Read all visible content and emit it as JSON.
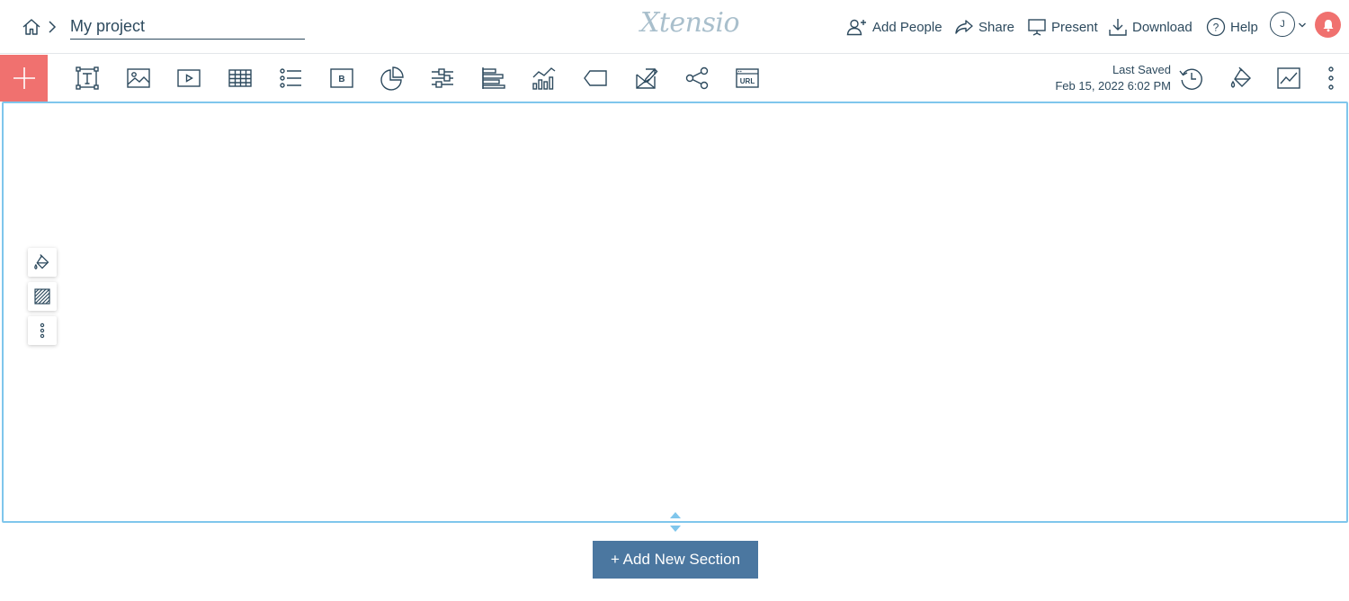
{
  "header": {
    "project_name": "My project",
    "logo_text": "Xtensio",
    "actions": {
      "add_people": "Add People",
      "share": "Share",
      "present": "Present",
      "download": "Download",
      "help": "Help"
    },
    "avatar_initial": "J"
  },
  "toolbar": {
    "tools": [
      "text-box-icon",
      "image-icon",
      "video-icon",
      "table-icon",
      "list-icon",
      "button-icon",
      "pie-chart-icon",
      "slider-icon",
      "bar-chart-icon",
      "column-chart-icon",
      "tag-icon",
      "form-icon",
      "social-share-icon",
      "url-embed-icon"
    ],
    "last_saved_label": "Last Saved",
    "last_saved_time": "Feb 15, 2022 6:02 PM",
    "right_tools": [
      "history-icon",
      "paint-bucket-icon",
      "analytics-icon",
      "more-vertical-icon"
    ]
  },
  "section": {
    "side_tools": [
      "paint-bucket-icon",
      "texture-icon",
      "more-vertical-icon"
    ]
  },
  "add_section_label": "+ Add New Section",
  "colors": {
    "primary_text": "#2d4a5e",
    "accent": "#f0716f",
    "section_border": "#7fc6ec",
    "button_blue": "#4b77a0"
  }
}
